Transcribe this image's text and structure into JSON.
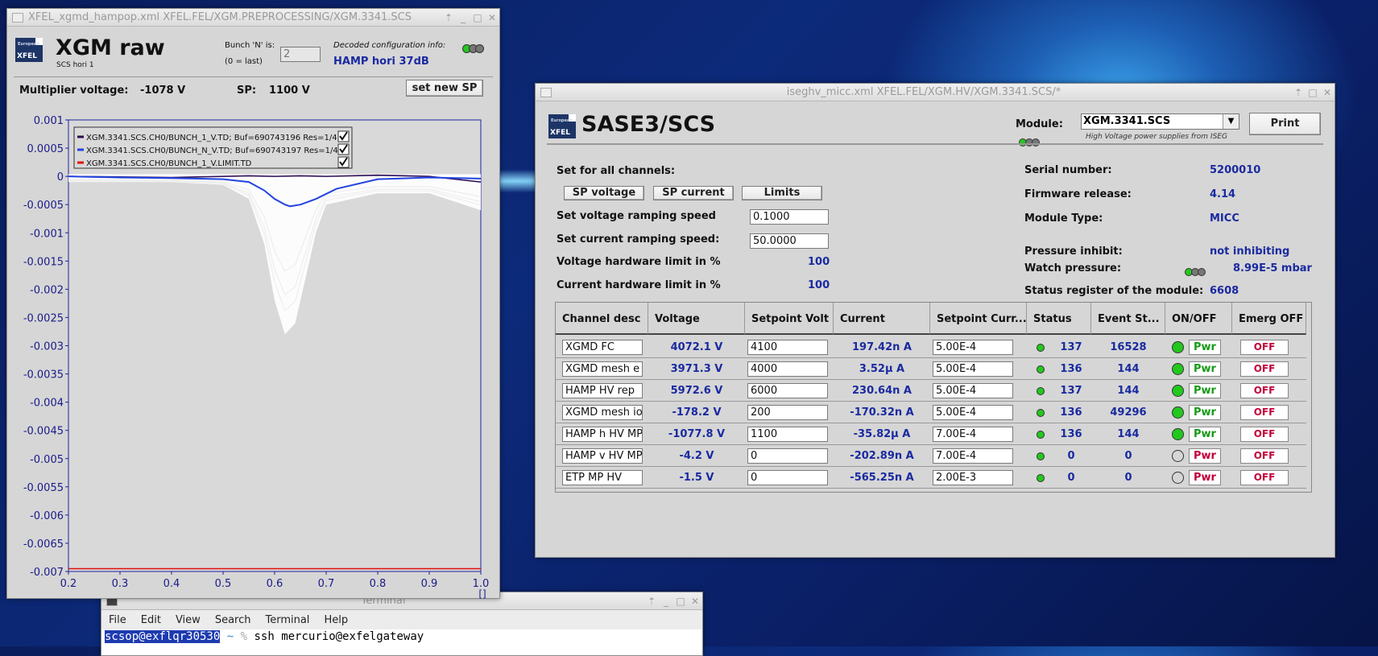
{
  "xgm_window": {
    "title": "XFEL_xgmd_hampop.xml   XFEL.FEL/XGM.PREPROCESSING/XGM.3341.SCS",
    "logo_text": "XFEL",
    "logo_sub": "European",
    "heading": "XGM raw",
    "subheading": "SCS hori 1",
    "bunch_label": "Bunch 'N' is:",
    "bunch_hint": "(0 = last)",
    "bunch_value": "2",
    "decoded_label": "Decoded configuration info:",
    "decoded_value": "HAMP hori 37dB",
    "mult_label": "Multiplier voltage:",
    "mult_value": "-1078 V",
    "sp_label": "SP:",
    "sp_value": "1100 V",
    "set_sp_button": "set new SP"
  },
  "chart_data": {
    "type": "line",
    "xlim": [
      0.2,
      1.0
    ],
    "ylim": [
      -0.007,
      0.001
    ],
    "x_ticks": [
      "0.2",
      "0.3",
      "0.4",
      "0.5",
      "0.6",
      "0.7",
      "0.8",
      "0.9",
      "1.0"
    ],
    "y_ticks": [
      "0.001",
      "0.0005",
      "0",
      "-0.0005",
      "-0.001",
      "-0.0015",
      "-0.002",
      "-0.0025",
      "-0.003",
      "-0.0035",
      "-0.004",
      "-0.0045",
      "-0.005",
      "-0.0055",
      "-0.006",
      "-0.0065",
      "-0.007"
    ],
    "x_unit": "[]",
    "series": [
      {
        "name": "XGM.3341.SCS.CH0/BUNCH_1_V.TD; Buf=690743196 Res=1/4",
        "color": "#2a0a55",
        "x": [
          0.2,
          0.4,
          0.55,
          0.6,
          0.65,
          0.7,
          0.8,
          0.9,
          1.0
        ],
        "y": [
          0,
          -2e-05,
          1e-05,
          0,
          1e-05,
          0,
          2e-05,
          0,
          -0.0001
        ]
      },
      {
        "name": "XGM.3341.SCS.CH0/BUNCH_N_V.TD; Buf=690743197 Res=1/4",
        "color": "#2244e0",
        "x": [
          0.2,
          0.3,
          0.4,
          0.5,
          0.55,
          0.58,
          0.6,
          0.62,
          0.63,
          0.65,
          0.68,
          0.72,
          0.8,
          0.9,
          1.0
        ],
        "y": [
          0,
          -2e-05,
          -3e-05,
          -5e-05,
          -0.0001,
          -0.00025,
          -0.0004,
          -0.0005,
          -0.00053,
          -0.0005,
          -0.0004,
          -0.00022,
          -5e-05,
          -2e-05,
          -4e-05
        ]
      },
      {
        "name": "XGM.3341.SCS.CH0/BUNCH_1_V.LIMIT.TD",
        "color": "#e01010",
        "x": [
          0.2,
          1.0
        ],
        "y": [
          -0.00695,
          -0.00695
        ]
      }
    ],
    "envelope": {
      "color": "#ffffff",
      "x": [
        0.2,
        0.4,
        0.5,
        0.55,
        0.58,
        0.6,
        0.62,
        0.64,
        0.66,
        0.68,
        0.7,
        0.75,
        0.8,
        0.9,
        1.0
      ],
      "y": [
        -0.0001,
        -0.0001,
        -0.00015,
        -0.0004,
        -0.0012,
        -0.0022,
        -0.0028,
        -0.0026,
        -0.0018,
        -0.001,
        -0.0005,
        -0.0004,
        -0.0003,
        -0.0003,
        -0.0006
      ]
    }
  },
  "hv_window": {
    "title": "iseghv_micc.xml   XFEL.FEL/XGM.HV/XGM.3341.SCS/*",
    "heading": "SASE3/SCS",
    "module_label": "Module:",
    "module_value": "XGM.3341.SCS",
    "module_sub": "High Voltage power supplies from ISEG",
    "print_button": "Print",
    "set_all_label": "Set for all channels:",
    "btn_sp_voltage": "SP voltage",
    "btn_sp_current": "SP current",
    "btn_limits": "Limits",
    "vramp_label": "Set voltage ramping speed",
    "vramp_value": "0.1000",
    "cramp_label": "Set current ramping speed:",
    "cramp_value": "50.0000",
    "vlimit_label": "Voltage hardware limit in %",
    "vlimit_value": "100",
    "climit_label": "Current hardware limit in %",
    "climit_value": "100",
    "serial_label": "Serial number:",
    "serial_value": "5200010",
    "fw_label": "Firmware release:",
    "fw_value": "4.14",
    "type_label": "Module Type:",
    "type_value": "MICC",
    "pinhibit_label": "Pressure inhibit:",
    "pinhibit_value": "not inhibiting",
    "watch_label": "Watch pressure:",
    "watch_value": "8.99E-5 mbar",
    "status_label": "Status register of the module:",
    "status_value": "6608",
    "columns": [
      "Channel desc",
      "Voltage",
      "Setpoint Volt",
      "Current",
      "Setpoint Curr...",
      "Status",
      "Event St...",
      "ON/OFF",
      "Emerg OFF"
    ],
    "rows": [
      {
        "desc": "XGMD FC",
        "voltage": "4072.1 V",
        "sp_volt": "4100",
        "current": "197.42n A",
        "sp_curr": "5.00E-4",
        "status": "137",
        "event": "16528",
        "on": true,
        "pwr": "Pwr",
        "off": "OFF"
      },
      {
        "desc": "XGMD mesh e",
        "voltage": "3971.3 V",
        "sp_volt": "4000",
        "current": "3.52µ A",
        "sp_curr": "5.00E-4",
        "status": "136",
        "event": "144",
        "on": true,
        "pwr": "Pwr",
        "off": "OFF"
      },
      {
        "desc": "HAMP HV rep",
        "voltage": "5972.6 V",
        "sp_volt": "6000",
        "current": "230.64n A",
        "sp_curr": "5.00E-4",
        "status": "137",
        "event": "144",
        "on": true,
        "pwr": "Pwr",
        "off": "OFF"
      },
      {
        "desc": "XGMD mesh ion",
        "voltage": "-178.2 V",
        "sp_volt": "200",
        "current": "-170.32n A",
        "sp_curr": "5.00E-4",
        "status": "136",
        "event": "49296",
        "on": true,
        "pwr": "Pwr",
        "off": "OFF"
      },
      {
        "desc": "HAMP h HV MP",
        "voltage": "-1077.8 V",
        "sp_volt": "1100",
        "current": "-35.82µ A",
        "sp_curr": "7.00E-4",
        "status": "136",
        "event": "144",
        "on": true,
        "pwr": "Pwr",
        "off": "OFF"
      },
      {
        "desc": "HAMP v HV MP",
        "voltage": "-4.2 V",
        "sp_volt": "0",
        "current": "-202.89n A",
        "sp_curr": "7.00E-4",
        "status": "0",
        "event": "0",
        "on": false,
        "pwr": "Pwr",
        "off": "OFF"
      },
      {
        "desc": "ETP MP HV",
        "voltage": "-1.5 V",
        "sp_volt": "0",
        "current": "-565.25n A",
        "sp_curr": "2.00E-3",
        "status": "0",
        "event": "0",
        "on": false,
        "pwr": "Pwr",
        "off": "OFF"
      }
    ]
  },
  "terminal": {
    "title": "Terminal",
    "menu": [
      "File",
      "Edit",
      "View",
      "Search",
      "Terminal",
      "Help"
    ],
    "prompt_user": "scsop@exflqr30530",
    "prompt_path": "~",
    "prompt_sym": "%",
    "command": "ssh mercurio@exfelgateway"
  }
}
